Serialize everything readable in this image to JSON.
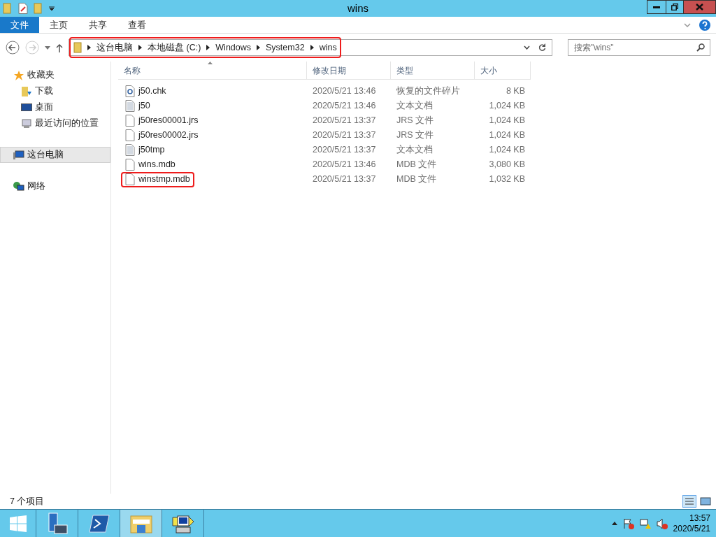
{
  "window": {
    "title": "wins"
  },
  "ribbon_tabs": [
    {
      "label": "文件",
      "selected": true
    },
    {
      "label": "主页",
      "selected": false
    },
    {
      "label": "共享",
      "selected": false
    },
    {
      "label": "查看",
      "selected": false
    }
  ],
  "address": {
    "highlighted": true,
    "crumbs": [
      "这台电脑",
      "本地磁盘 (C:)",
      "Windows",
      "System32",
      "wins"
    ]
  },
  "search": {
    "placeholder": "搜索\"wins\""
  },
  "sidebar": {
    "items": [
      {
        "label": "收藏夹",
        "kind": "star",
        "selected": false,
        "children": [
          {
            "label": "下载",
            "kind": "download",
            "selected": false
          },
          {
            "label": "桌面",
            "kind": "desktop",
            "selected": false
          },
          {
            "label": "最近访问的位置",
            "kind": "recent",
            "selected": false
          }
        ]
      },
      {
        "label": "这台电脑",
        "kind": "computer",
        "selected": true
      },
      {
        "label": "网络",
        "kind": "network",
        "selected": false
      }
    ]
  },
  "table": {
    "columns": [
      "名称",
      "修改日期",
      "类型",
      "大小"
    ],
    "rows": [
      {
        "name": "j50.chk",
        "kind": "chk",
        "modified": "2020/5/21 13:46",
        "type": "恢复的文件碎片",
        "size": "8 KB",
        "highlighted": false
      },
      {
        "name": "j50",
        "kind": "text",
        "modified": "2020/5/21 13:46",
        "type": "文本文档",
        "size": "1,024 KB",
        "highlighted": false
      },
      {
        "name": "j50res00001.jrs",
        "kind": "blank",
        "modified": "2020/5/21 13:37",
        "type": "JRS 文件",
        "size": "1,024 KB",
        "highlighted": false
      },
      {
        "name": "j50res00002.jrs",
        "kind": "blank",
        "modified": "2020/5/21 13:37",
        "type": "JRS 文件",
        "size": "1,024 KB",
        "highlighted": false
      },
      {
        "name": "j50tmp",
        "kind": "text",
        "modified": "2020/5/21 13:37",
        "type": "文本文档",
        "size": "1,024 KB",
        "highlighted": false
      },
      {
        "name": "wins.mdb",
        "kind": "blank",
        "modified": "2020/5/21 13:46",
        "type": "MDB 文件",
        "size": "3,080 KB",
        "highlighted": false
      },
      {
        "name": "winstmp.mdb",
        "kind": "blank",
        "modified": "2020/5/21 13:37",
        "type": "MDB 文件",
        "size": "1,032 KB",
        "highlighted": true
      }
    ]
  },
  "status_bar": {
    "count": "7 个项目"
  },
  "taskbar": {
    "apps": [
      {
        "kind": "start",
        "selected": false
      },
      {
        "kind": "server",
        "selected": false
      },
      {
        "kind": "shell",
        "selected": false
      },
      {
        "kind": "explorer",
        "selected": true
      },
      {
        "kind": "tool",
        "selected": false
      }
    ],
    "time": "13:57",
    "date": "2020/5/21"
  }
}
